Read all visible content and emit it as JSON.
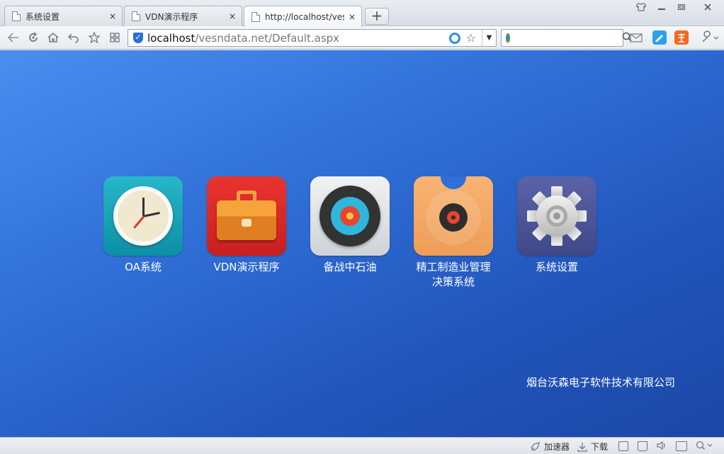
{
  "tabs": [
    {
      "title": "系统设置",
      "active": false
    },
    {
      "title": "VDN演示程序",
      "active": false
    },
    {
      "title": "http://localhost/vesndata.net/Default.aspx",
      "active": true
    }
  ],
  "new_tab_label": "+",
  "tab_close_glyph": "×",
  "address_bar": {
    "host": "localhost",
    "path": "/vesndata.net/Default.aspx",
    "dropdown_glyph": "▼"
  },
  "search": {
    "value": "",
    "placeholder": ""
  },
  "apps": [
    {
      "label": "OA系统",
      "icon": "clock-icon"
    },
    {
      "label": "VDN演示程序",
      "icon": "briefcase-icon"
    },
    {
      "label": "备战中石油",
      "icon": "target-icon"
    },
    {
      "label": "精工制造业管理决策系统",
      "label_line1": "精工制造业管理",
      "label_line2": "决策系统",
      "icon": "record-icon"
    },
    {
      "label": "系统设置",
      "icon": "gear-icon"
    }
  ],
  "footer": {
    "company": "烟台沃森电子软件技术有限公司"
  },
  "statusbar": {
    "accelerator_label": "加速器",
    "download_label": "下载"
  },
  "colors": {
    "desktop_top": "#4a8ef0",
    "desktop_bottom": "#1b47a6",
    "address_shield": "#2a6fd6"
  }
}
